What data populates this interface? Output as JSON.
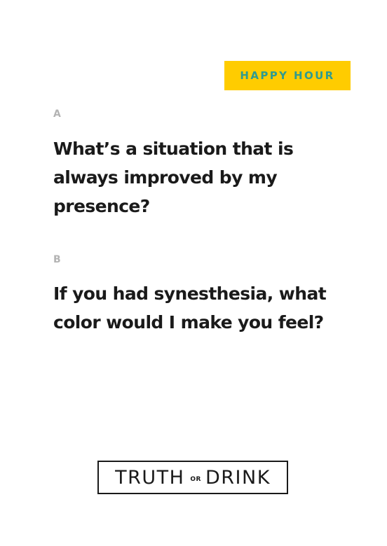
{
  "badge": {
    "label": "HAPPY HOUR",
    "background_color": "#ffcc00",
    "text_color": "#2f9b8f"
  },
  "questions": [
    {
      "letter": "A",
      "text": "What’s a situation that is always improved by my presence?"
    },
    {
      "letter": "B",
      "text": "If you had synesthesia, what color would I make you feel?"
    }
  ],
  "logo": {
    "word_left": "TRUTH",
    "word_middle": "OR",
    "word_right": "DRINK"
  },
  "colors": {
    "text": "#1a1a1a",
    "letter": "#b3b3b3",
    "background": "#ffffff"
  }
}
